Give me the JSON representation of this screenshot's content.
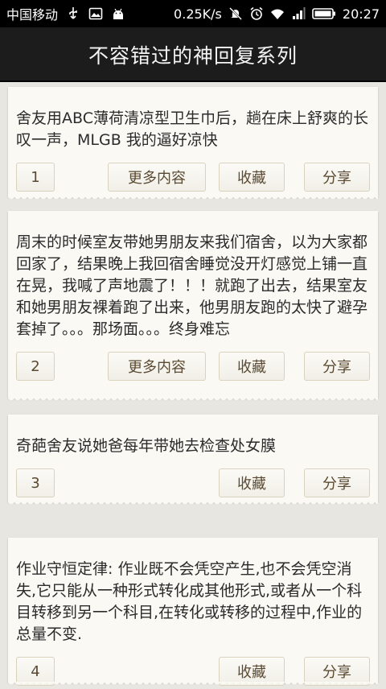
{
  "status_bar": {
    "carrier": "中国移动",
    "net_speed": "0.25K/s",
    "time": "20:27"
  },
  "header": {
    "title": "不容错过的神回复系列"
  },
  "posts": [
    {
      "text": "舍友用ABC薄荷清凉型卫生巾后，趟在床上舒爽的长叹一声，MLGB 我的逼好凉快",
      "index": "1",
      "more_label": "更多内容",
      "fav_label": "收藏",
      "share_label": "分享"
    },
    {
      "text": "周末的时候室友带她男朋友来我们宿舍，以为大家都回家了，结果晚上我回宿舍睡觉没开灯感觉上铺一直在晃，我喊了声地震了！！！就跑了出去，结果室友和她男朋友裸着跑了出来，他男朋友跑的太快了避孕套掉了。。。那场面。。。终身难忘",
      "index": "2",
      "more_label": "更多内容",
      "fav_label": "收藏",
      "share_label": "分享"
    },
    {
      "text": "奇葩舍友说她爸每年带她去检查处女膜",
      "index": "3",
      "fav_label": "收藏",
      "share_label": "分享"
    },
    {
      "text": "作业守恒定律: 作业既不会凭空产生,也不会凭空消失,它只能从一种形式转化成其他形式,或者从一个科目转移到另一个科目,在转化或转移的过程中,作业的总量不变.",
      "index": "4",
      "fav_label": "收藏",
      "share_label": "分享"
    }
  ]
}
